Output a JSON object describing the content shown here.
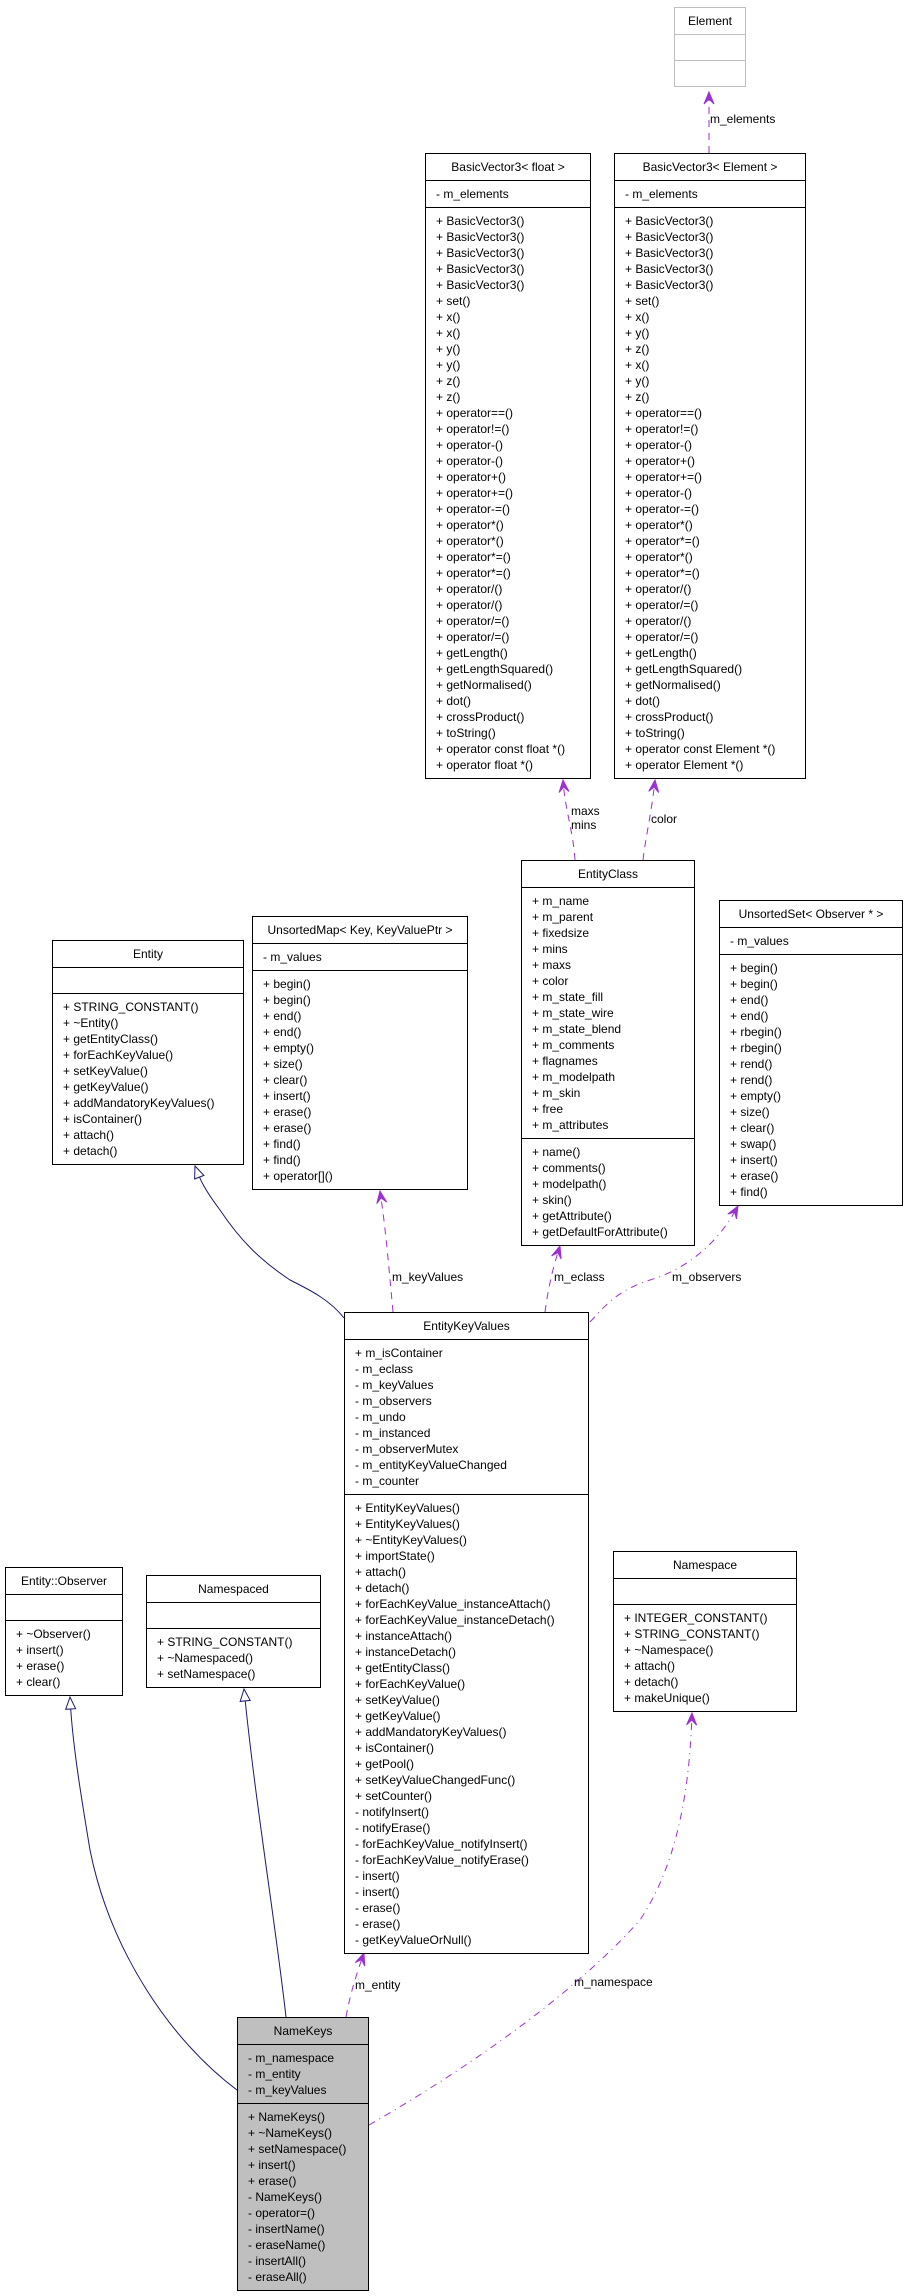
{
  "colors": {
    "association": "#9a32cd",
    "inheritance": "#191970",
    "focus_fill": "#bfbfbf"
  },
  "classes": {
    "Element": {
      "name": "Element",
      "attributes": [],
      "methods": [],
      "style": "undocumented"
    },
    "BV3Float": {
      "name": "BasicVector3< float >",
      "attributes": [
        "- m_elements"
      ],
      "methods": [
        "+ BasicVector3()",
        "+ BasicVector3()",
        "+ BasicVector3()",
        "+ BasicVector3()",
        "+ BasicVector3()",
        "+ set()",
        "+ x()",
        "+ x()",
        "+ y()",
        "+ y()",
        "+ z()",
        "+ z()",
        "+ operator==()",
        "+ operator!=()",
        "+ operator-()",
        "+ operator-()",
        "+ operator+()",
        "+ operator+=()",
        "+ operator-=()",
        "+ operator*()",
        "+ operator*()",
        "+ operator*=()",
        "+ operator*=()",
        "+ operator/()",
        "+ operator/()",
        "+ operator/=()",
        "+ operator/=()",
        "+ getLength()",
        "+ getLengthSquared()",
        "+ getNormalised()",
        "+ dot()",
        "+ crossProduct()",
        "+ toString()",
        "+ operator const float *()",
        "+ operator float *()"
      ]
    },
    "BV3Element": {
      "name": "BasicVector3< Element >",
      "attributes": [
        "- m_elements"
      ],
      "methods": [
        "+ BasicVector3()",
        "+ BasicVector3()",
        "+ BasicVector3()",
        "+ BasicVector3()",
        "+ BasicVector3()",
        "+ set()",
        "+ x()",
        "+ y()",
        "+ z()",
        "+ x()",
        "+ y()",
        "+ z()",
        "+ operator==()",
        "+ operator!=()",
        "+ operator-()",
        "+ operator+()",
        "+ operator+=()",
        "+ operator-()",
        "+ operator-=()",
        "+ operator*()",
        "+ operator*=()",
        "+ operator*()",
        "+ operator*=()",
        "+ operator/()",
        "+ operator/=()",
        "+ operator/()",
        "+ operator/=()",
        "+ getLength()",
        "+ getLengthSquared()",
        "+ getNormalised()",
        "+ dot()",
        "+ crossProduct()",
        "+ toString()",
        "+ operator const Element *()",
        "+ operator Element *()"
      ]
    },
    "EntityClass": {
      "name": "EntityClass",
      "attributes": [
        "+ m_name",
        "+ m_parent",
        "+ fixedsize",
        "+ mins",
        "+ maxs",
        "+ color",
        "+ m_state_fill",
        "+ m_state_wire",
        "+ m_state_blend",
        "+ m_comments",
        "+ flagnames",
        "+ m_modelpath",
        "+ m_skin",
        "+ free",
        "+ m_attributes"
      ],
      "methods": [
        "+ name()",
        "+ comments()",
        "+ modelpath()",
        "+ skin()",
        "+ getAttribute()",
        "+ getDefaultForAttribute()"
      ]
    },
    "Entity": {
      "name": "Entity",
      "attributes": [],
      "methods": [
        "+ STRING_CONSTANT()",
        "+ ~Entity()",
        "+ getEntityClass()",
        "+ forEachKeyValue()",
        "+ setKeyValue()",
        "+ getKeyValue()",
        "+ addMandatoryKeyValues()",
        "+ isContainer()",
        "+ attach()",
        "+ detach()"
      ]
    },
    "UnsortedMap": {
      "name": "UnsortedMap< Key, KeyValuePtr >",
      "attributes": [
        "- m_values"
      ],
      "methods": [
        "+ begin()",
        "+ begin()",
        "+ end()",
        "+ end()",
        "+ empty()",
        "+ size()",
        "+ clear()",
        "+ insert()",
        "+ erase()",
        "+ erase()",
        "+ find()",
        "+ find()",
        "+ operator[]()"
      ]
    },
    "UnsortedSet": {
      "name": "UnsortedSet< Observer * >",
      "attributes": [
        "- m_values"
      ],
      "methods": [
        "+ begin()",
        "+ begin()",
        "+ end()",
        "+ end()",
        "+ rbegin()",
        "+ rbegin()",
        "+ rend()",
        "+ rend()",
        "+ empty()",
        "+ size()",
        "+ clear()",
        "+ swap()",
        "+ insert()",
        "+ erase()",
        "+ find()"
      ]
    },
    "EntityKeyValues": {
      "name": "EntityKeyValues",
      "attributes": [
        "+ m_isContainer",
        "- m_eclass",
        "- m_keyValues",
        "- m_observers",
        "- m_undo",
        "- m_instanced",
        "- m_observerMutex",
        "- m_entityKeyValueChanged",
        "- m_counter"
      ],
      "methods": [
        "+ EntityKeyValues()",
        "+ EntityKeyValues()",
        "+ ~EntityKeyValues()",
        "+ importState()",
        "+ attach()",
        "+ detach()",
        "+ forEachKeyValue_instanceAttach()",
        "+ forEachKeyValue_instanceDetach()",
        "+ instanceAttach()",
        "+ instanceDetach()",
        "+ getEntityClass()",
        "+ forEachKeyValue()",
        "+ setKeyValue()",
        "+ getKeyValue()",
        "+ addMandatoryKeyValues()",
        "+ isContainer()",
        "+ getPool()",
        "+ setKeyValueChangedFunc()",
        "+ setCounter()",
        "- notifyInsert()",
        "- notifyErase()",
        "- forEachKeyValue_notifyInsert()",
        "- forEachKeyValue_notifyErase()",
        "- insert()",
        "- insert()",
        "- erase()",
        "- erase()",
        "- getKeyValueOrNull()"
      ]
    },
    "Observer": {
      "name": "Entity::Observer",
      "attributes": [],
      "methods": [
        "+ ~Observer()",
        "+ insert()",
        "+ erase()",
        "+ clear()"
      ]
    },
    "Namespaced": {
      "name": "Namespaced",
      "attributes": [],
      "methods": [
        "+ STRING_CONSTANT()",
        "+ ~Namespaced()",
        "+ setNamespace()"
      ]
    },
    "Namespace": {
      "name": "Namespace",
      "attributes": [],
      "methods": [
        "+ INTEGER_CONSTANT()",
        "+ STRING_CONSTANT()",
        "+ ~Namespace()",
        "+ attach()",
        "+ detach()",
        "+ makeUnique()"
      ]
    },
    "NameKeys": {
      "name": "NameKeys",
      "attributes": [
        "- m_namespace",
        "- m_entity",
        "- m_keyValues"
      ],
      "methods": [
        "+ NameKeys()",
        "+ ~NameKeys()",
        "+ setNamespace()",
        "+ insert()",
        "+ erase()",
        "- NameKeys()",
        "- operator=()",
        "- insertName()",
        "- eraseName()",
        "- insertAll()",
        "- eraseAll()"
      ],
      "style": "focus"
    }
  },
  "edges": [
    {
      "id": "e1",
      "from": "BV3Element",
      "to": "Element",
      "kind": "association",
      "label": "m_elements"
    },
    {
      "id": "e2",
      "from": "EntityClass",
      "to": "BV3Float",
      "kind": "association",
      "label": "maxs\nmins"
    },
    {
      "id": "e3",
      "from": "EntityClass",
      "to": "BV3Element",
      "kind": "association",
      "label": "color"
    },
    {
      "id": "e4",
      "from": "EntityKeyValues",
      "to": "Entity",
      "kind": "inheritance",
      "label": ""
    },
    {
      "id": "e5",
      "from": "EntityKeyValues",
      "to": "UnsortedMap",
      "kind": "association",
      "label": "m_keyValues"
    },
    {
      "id": "e6",
      "from": "EntityKeyValues",
      "to": "EntityClass",
      "kind": "association",
      "label": "m_eclass"
    },
    {
      "id": "e7",
      "from": "EntityKeyValues",
      "to": "UnsortedSet",
      "kind": "template",
      "label": "m_observers"
    },
    {
      "id": "e8",
      "from": "NameKeys",
      "to": "Observer",
      "kind": "inheritance",
      "label": ""
    },
    {
      "id": "e9",
      "from": "NameKeys",
      "to": "Namespaced",
      "kind": "inheritance",
      "label": ""
    },
    {
      "id": "e10",
      "from": "NameKeys",
      "to": "EntityKeyValues",
      "kind": "association",
      "label": "m_entity"
    },
    {
      "id": "e11",
      "from": "NameKeys",
      "to": "Namespace",
      "kind": "template",
      "label": "m_namespace"
    }
  ]
}
